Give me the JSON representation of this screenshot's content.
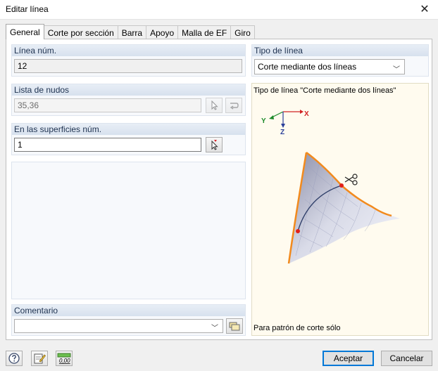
{
  "window": {
    "title": "Editar línea"
  },
  "tabs": [
    {
      "label": "General"
    },
    {
      "label": "Corte por sección"
    },
    {
      "label": "Barra"
    },
    {
      "label": "Apoyo"
    },
    {
      "label": "Malla de EF"
    },
    {
      "label": "Giro"
    }
  ],
  "line_number": {
    "label": "Línea núm.",
    "value": "12"
  },
  "node_list": {
    "label": "Lista de nudos",
    "value": "35,36"
  },
  "surfaces": {
    "label": "En las superficies núm.",
    "value": "1"
  },
  "comment": {
    "label": "Comentario",
    "value": ""
  },
  "line_type": {
    "label": "Tipo de línea",
    "selected": "Corte mediante dos líneas"
  },
  "preview": {
    "title": "Tipo de línea \"Corte mediante dos líneas\"",
    "footer": "Para patrón de corte sólo",
    "axes": {
      "x": "X",
      "y": "Y",
      "z": "Z"
    }
  },
  "buttons": {
    "ok": "Aceptar",
    "cancel": "Cancelar"
  },
  "icons": [
    "help-icon",
    "edit-icon",
    "units-icon",
    "pick-icon",
    "select-icon",
    "library-icon",
    "close-icon",
    "scissors-icon"
  ],
  "colors": {
    "accent": "#0078d7",
    "surface_edge": "#f28a1d",
    "cut_point": "#e0201a"
  }
}
